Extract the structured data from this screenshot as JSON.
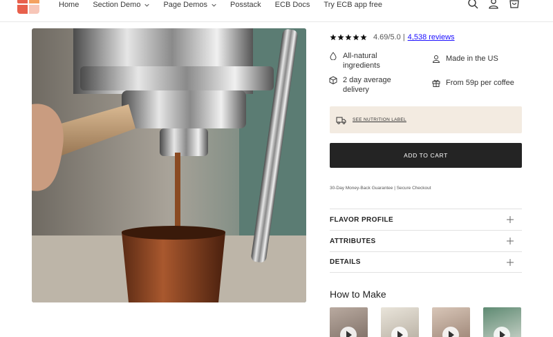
{
  "header": {
    "nav": [
      {
        "label": "Home",
        "dropdown": false
      },
      {
        "label": "Section Demo",
        "dropdown": true
      },
      {
        "label": "Page Demos",
        "dropdown": true
      },
      {
        "label": "Posstack",
        "dropdown": false
      },
      {
        "label": "ECB Docs",
        "dropdown": false
      },
      {
        "label": "Try ECB app free",
        "dropdown": false
      }
    ],
    "icons": [
      "search-icon",
      "account-icon",
      "cart-icon"
    ],
    "logo_colors": [
      "#e8604c",
      "#f4a261",
      "#e8604c",
      "#f7c6b8"
    ]
  },
  "product": {
    "rating": {
      "stars": 5,
      "score_text": "4.69/5.0 |",
      "reviews_text": "4,538 reviews"
    },
    "features": [
      {
        "icon": "drop-icon",
        "text": "All-natural ingredients"
      },
      {
        "icon": "person-icon",
        "text": "Made in the US"
      },
      {
        "icon": "box-icon",
        "text": "2 day average delivery"
      },
      {
        "icon": "gift-icon",
        "text": "From 59p per coffee"
      }
    ],
    "nutrition_label": "SEE NUTRITION LABEL",
    "add_to_cart": "ADD TO CART",
    "guarantee": "30-Day Money-Back Guarantee | Secure Checkout",
    "accordion": [
      "FLAVOR PROFILE",
      "ATTRIBUTES",
      "DETAILS"
    ],
    "how_to_make": {
      "title": "How to Make",
      "videos": 4
    }
  },
  "colors": {
    "accent_box": "#f3ebe1",
    "button": "#242424",
    "link": "#1a0dff"
  }
}
